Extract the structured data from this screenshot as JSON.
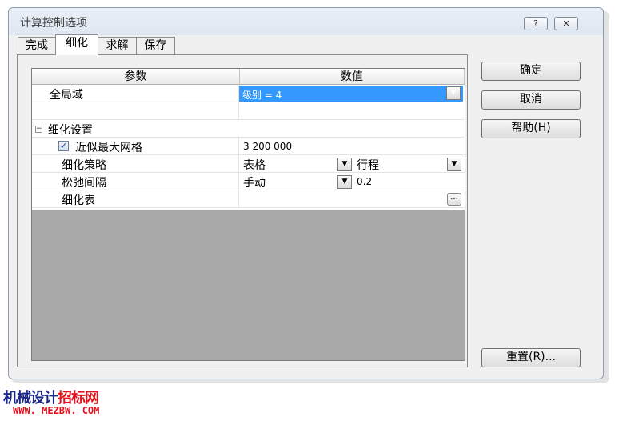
{
  "dialog": {
    "title": "计算控制选项",
    "help_glyph": "?",
    "close_glyph": "✕"
  },
  "tabs": [
    {
      "label": "完成",
      "active": false
    },
    {
      "label": "细化",
      "active": true
    },
    {
      "label": "求解",
      "active": false
    },
    {
      "label": "保存",
      "active": false
    }
  ],
  "grid": {
    "col_param": "参数",
    "col_value": "数值",
    "global": {
      "label": "全局域",
      "value": "级别 = 4"
    },
    "section": {
      "expander": "−",
      "label": "细化设置"
    },
    "approx_max_mesh": {
      "label": "近似最大网格",
      "checked": true,
      "value": "3 200 000"
    },
    "strategy": {
      "label": "细化策略",
      "value": "表格",
      "value2": "行程"
    },
    "relax": {
      "label": "松弛间隔",
      "value": "手动",
      "value2": "0.2"
    },
    "table": {
      "label": "细化表",
      "button": "..."
    }
  },
  "buttons": {
    "ok": "确定",
    "cancel": "取消",
    "help": "帮助(H)",
    "reset": "重置(R)..."
  },
  "watermark": {
    "cn_part1": "机械设计",
    "cn_part2": "招标网",
    "url": "WWW. MEZBW. COM"
  },
  "icons": {
    "dropdown": "▼",
    "check": "✓"
  }
}
